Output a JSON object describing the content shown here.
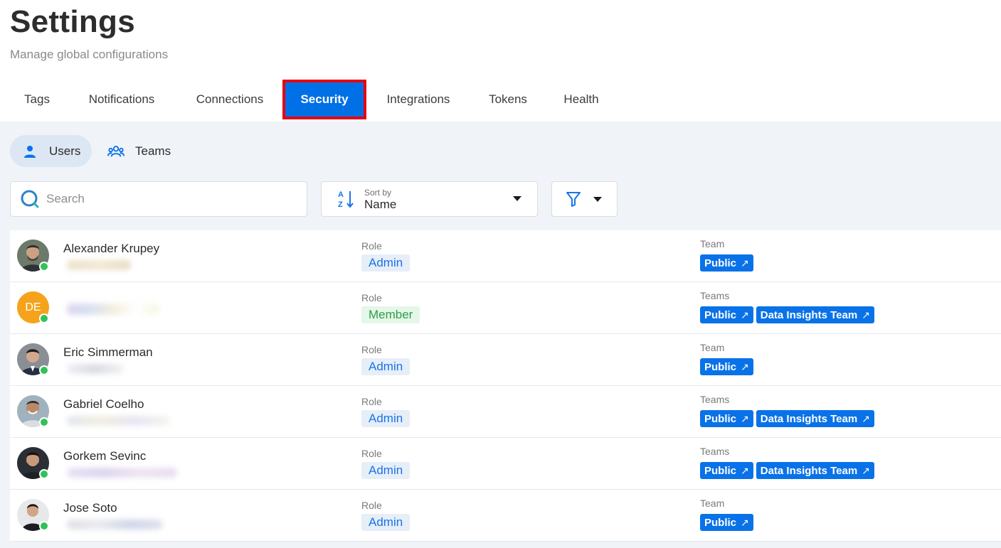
{
  "page": {
    "title": "Settings",
    "subtitle": "Manage global configurations"
  },
  "tabs": [
    {
      "label": "Tags"
    },
    {
      "label": "Notifications"
    },
    {
      "label": "Connections"
    },
    {
      "label": "Security",
      "active": true
    },
    {
      "label": "Integrations"
    },
    {
      "label": "Tokens"
    },
    {
      "label": "Health"
    }
  ],
  "subtabs": [
    {
      "label": "Users",
      "icon": "user-icon",
      "active": true
    },
    {
      "label": "Teams",
      "icon": "team-icon"
    }
  ],
  "search": {
    "placeholder": "Search",
    "value": ""
  },
  "sort": {
    "caption": "Sort by",
    "value": "Name"
  },
  "filter": {
    "icon": "filter-icon"
  },
  "colors": {
    "accent": "#0070e6",
    "highlight_border": "#e8000f",
    "online": "#2fc25b"
  },
  "users": [
    {
      "name": "Alexander Krupey",
      "role_label": "Role",
      "role": "Admin",
      "team_label": "Team",
      "teams": [
        "Public"
      ]
    },
    {
      "name": "",
      "initials": "DE",
      "role_label": "Role",
      "role": "Member",
      "team_label": "Teams",
      "teams": [
        "Public",
        "Data Insights Team"
      ]
    },
    {
      "name": "Eric Simmerman",
      "role_label": "Role",
      "role": "Admin",
      "team_label": "Team",
      "teams": [
        "Public"
      ]
    },
    {
      "name": "Gabriel Coelho",
      "role_label": "Role",
      "role": "Admin",
      "team_label": "Teams",
      "teams": [
        "Public",
        "Data Insights Team"
      ]
    },
    {
      "name": "Gorkem Sevinc",
      "role_label": "Role",
      "role": "Admin",
      "team_label": "Teams",
      "teams": [
        "Public",
        "Data Insights Team"
      ]
    },
    {
      "name": "Jose Soto",
      "role_label": "Role",
      "role": "Admin",
      "team_label": "Team",
      "teams": [
        "Public"
      ]
    }
  ]
}
